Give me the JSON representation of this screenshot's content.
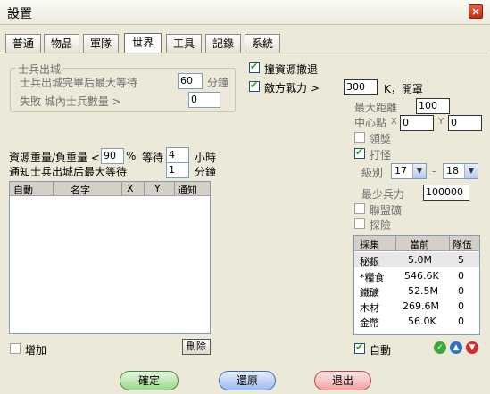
{
  "window": {
    "title": "設置",
    "close_icon": "close-icon"
  },
  "tabs": [
    {
      "label": "普通"
    },
    {
      "label": "物品"
    },
    {
      "label": "軍隊"
    },
    {
      "label": "世界"
    },
    {
      "label": "工具"
    },
    {
      "label": "記錄"
    },
    {
      "label": "系統"
    }
  ],
  "active_tab": "世界",
  "soldiers_group": {
    "legend": "士兵出城",
    "max_wait_label": "士兵出城完畢后最大等待",
    "max_wait_value": "60",
    "max_wait_unit": "分鐘",
    "fail_label": "失敗 城內士兵數量 >",
    "fail_value": "0"
  },
  "resource_weight": {
    "label": "資源重量/負重量 <",
    "value": "90",
    "unit": "%",
    "wait_label": "等待",
    "wait_value": "4",
    "wait_unit": "小時"
  },
  "notify": {
    "label": "通知士兵出城后最大等待",
    "value": "1",
    "unit": "分鐘"
  },
  "list": {
    "columns": [
      "自動",
      "名字",
      "X",
      "Y",
      "通知"
    ],
    "add_label": "增加",
    "delete_label": "刪除"
  },
  "right": {
    "retreat_label": "撞資源撤退",
    "enemy_power_label": "敵方戰力 >",
    "enemy_power_value": "300",
    "enemy_power_suffix": "K，開罩",
    "max_distance_label": "最大距離",
    "max_distance_value": "100",
    "center_label": "中心點",
    "x_label": "X",
    "x_value": "0",
    "y_label": "Y",
    "y_value": "0",
    "claim_label": "領獎",
    "fight_label": "打怪",
    "level_label": "級別",
    "level_from": "17",
    "level_dash": "-",
    "level_to": "18",
    "min_troops_label": "最少兵力",
    "min_troops_value": "100000",
    "alliance_label": "聯盟礦",
    "explore_label": "探險",
    "auto_label": "自動"
  },
  "resources": {
    "columns": [
      "採集",
      "當前",
      "隊伍"
    ],
    "rows": [
      {
        "name": "秘銀",
        "current": "5.0M",
        "team": "5"
      },
      {
        "name": "*糧食",
        "current": "546.6K",
        "team": "0"
      },
      {
        "name": "鐵礦",
        "current": "52.5M",
        "team": "0"
      },
      {
        "name": "木材",
        "current": "269.6M",
        "team": "0"
      },
      {
        "name": "金幣",
        "current": "56.0K",
        "team": "0"
      }
    ]
  },
  "buttons": {
    "ok": "確定",
    "restore": "還原",
    "exit": "退出"
  },
  "colors": {
    "background": "#ece9d8",
    "ok": "#9bd88b",
    "restore": "#9dbbee",
    "exit": "#f0a3a3"
  }
}
